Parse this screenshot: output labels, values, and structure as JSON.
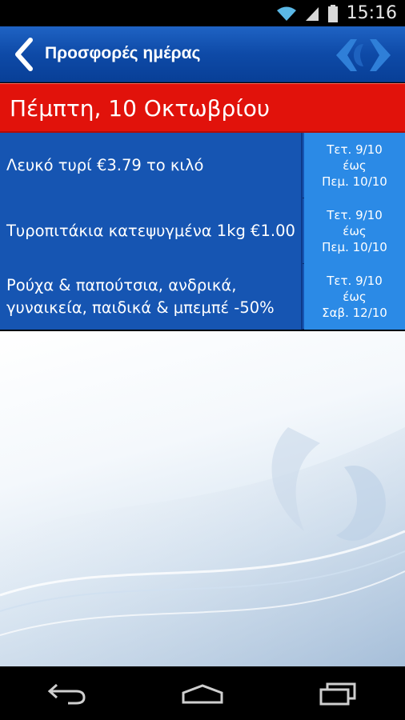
{
  "status_bar": {
    "time": "15:16",
    "icons": [
      "wifi-icon",
      "signal-icon",
      "battery-icon"
    ]
  },
  "header": {
    "title": "Προσφορές ημέρας",
    "back_icon": "chevron-left-icon",
    "logo": "carrefour-logo"
  },
  "date_banner": {
    "text": "Πέμπτη, 10 Οκτωβρίου"
  },
  "offers": [
    {
      "description": "Λευκό τυρί €3.79 το κιλό",
      "date_from": "Τετ. 9/10",
      "date_sep": "έως",
      "date_to": "Πεμ. 10/10"
    },
    {
      "description": "Τυροπιτάκια κατεψυγμένα 1kg €1.00",
      "date_from": "Τετ. 9/10",
      "date_sep": "έως",
      "date_to": "Πεμ. 10/10"
    },
    {
      "description": "Ρούχα & παπούτσια, ανδρικά, γυναικεία, παιδικά & μπεμπέ -50%",
      "date_from": "Τετ. 9/10",
      "date_sep": "έως",
      "date_to": "Σαβ. 12/10"
    }
  ],
  "nav_bar": {
    "buttons": [
      "back-nav-icon",
      "home-nav-icon",
      "recents-nav-icon"
    ]
  },
  "colors": {
    "header_blue": "#0e4aa7",
    "banner_red": "#e1120b",
    "offer_blue": "#1655b2",
    "date_cell_blue": "#2b8ae6"
  }
}
